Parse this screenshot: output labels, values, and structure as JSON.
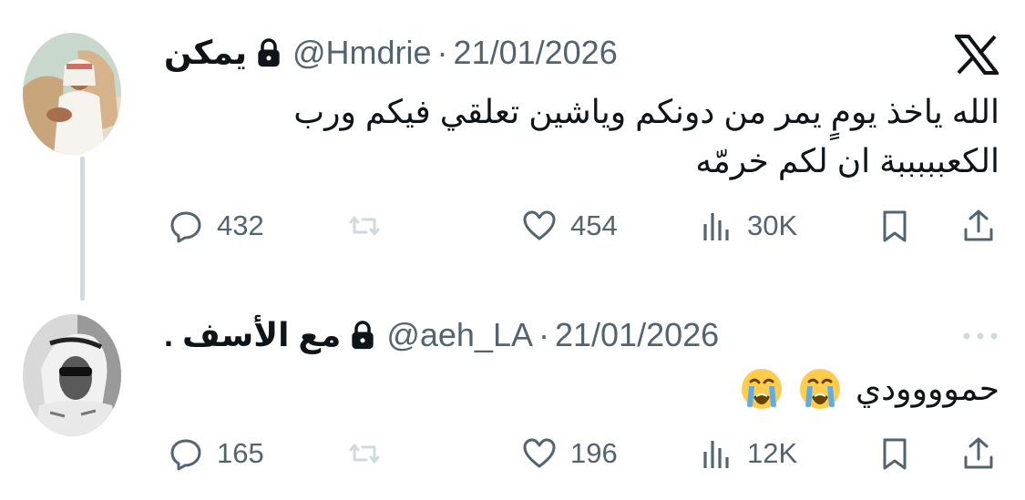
{
  "tweets": [
    {
      "name": "يمكن",
      "handle": "@Hmdrie",
      "separator": "·",
      "date": "21/01/2026",
      "text_line1": "الله ياخذ يومٍ يمر من دونكم وياشين تعلقي فيكم ورب",
      "text_line2": "الكعبببببة ان لكم خرمّه",
      "replies": "432",
      "likes": "454",
      "views": "30K",
      "avatar": "man-with-camel-photo"
    },
    {
      "name": "مع الأسف .",
      "handle": "@aeh_LA",
      "separator": "·",
      "date": "21/01/2026",
      "text": "حموووودي",
      "emoji": [
        "loudly-crying-face",
        "loudly-crying-face"
      ],
      "replies": "165",
      "likes": "196",
      "views": "12K",
      "avatar": "man-in-sunglasses-bw-photo"
    }
  ],
  "icons": {
    "brand": "x-logo",
    "reply": "reply-icon",
    "retweet": "retweet-icon",
    "like": "heart-icon",
    "views": "views-icon",
    "bookmark": "bookmark-icon",
    "share": "share-icon",
    "lock": "lock-icon",
    "more": "more-icon"
  },
  "colors": {
    "text": "#0f1419",
    "secondary": "#536471",
    "thread_line": "#cfd9de",
    "muted_icon": "#cfd9de"
  }
}
